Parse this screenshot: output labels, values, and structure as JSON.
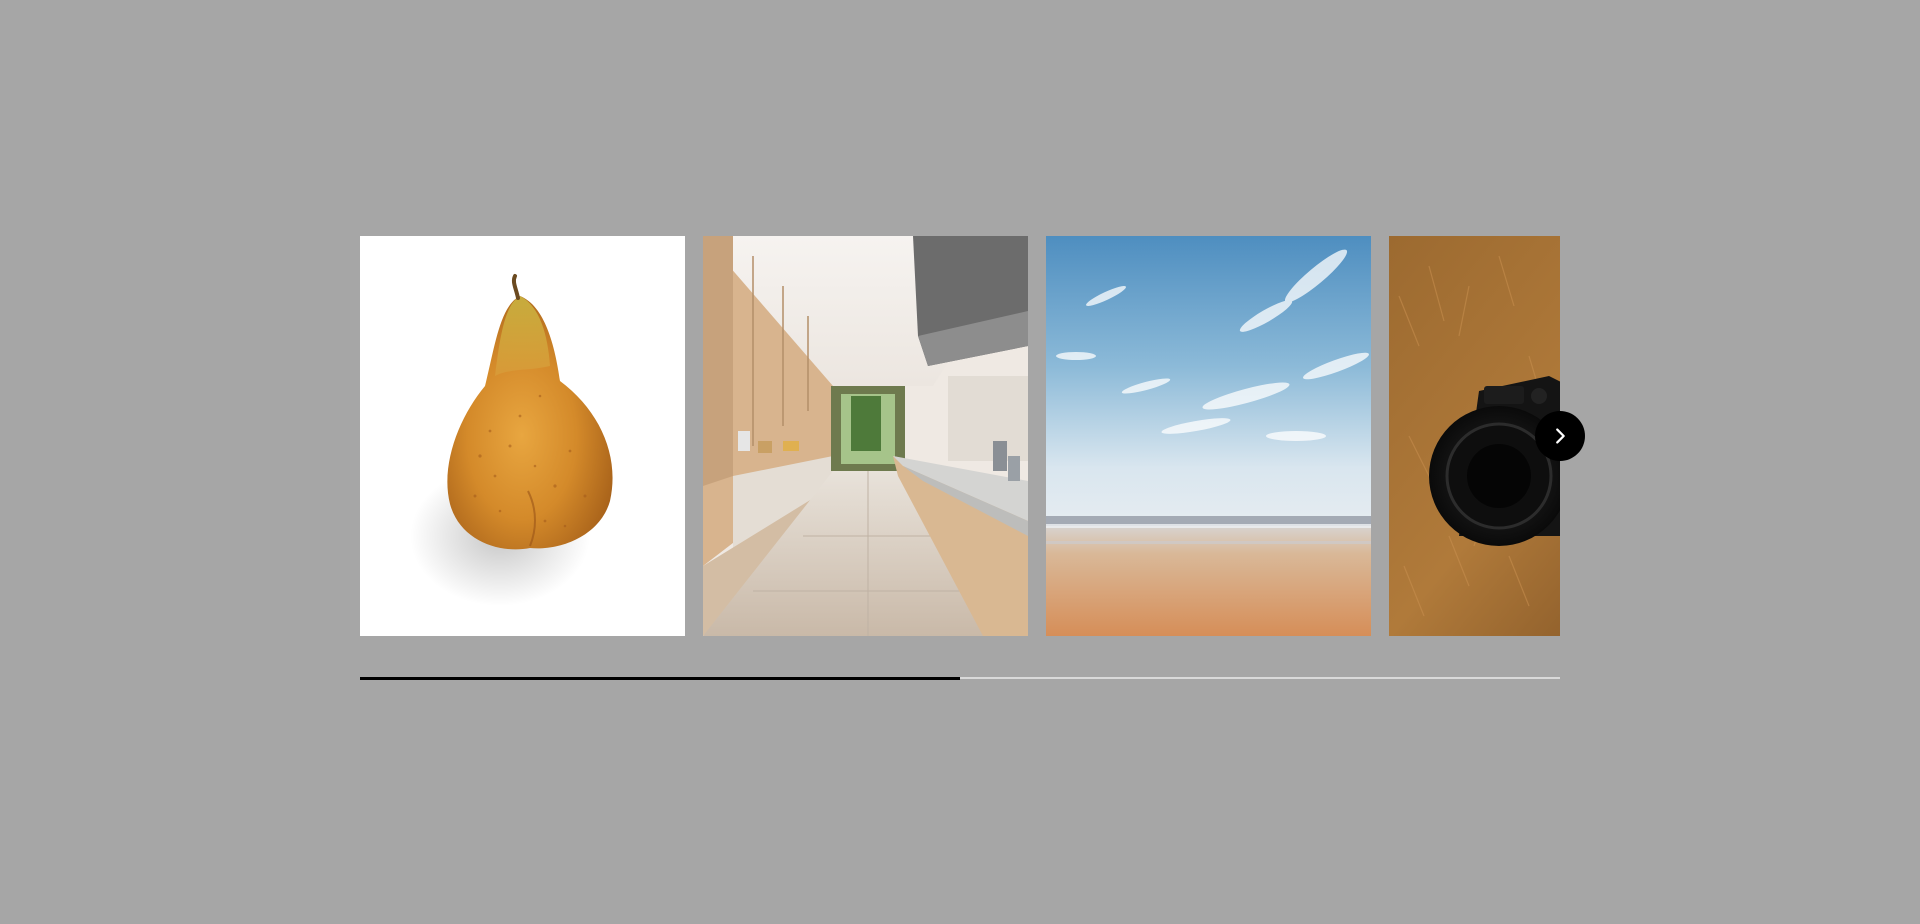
{
  "carousel": {
    "slides": [
      {
        "subject": "pear"
      },
      {
        "subject": "kitchen"
      },
      {
        "subject": "sky-beach"
      },
      {
        "subject": "camera-grass"
      }
    ],
    "next_icon": "chevron-right-icon",
    "progress": 0.5,
    "colors": {
      "background": "#a6a6a6",
      "progress_fill": "#000000",
      "progress_track": "#d9d9d9",
      "next_button": "#000000"
    }
  }
}
